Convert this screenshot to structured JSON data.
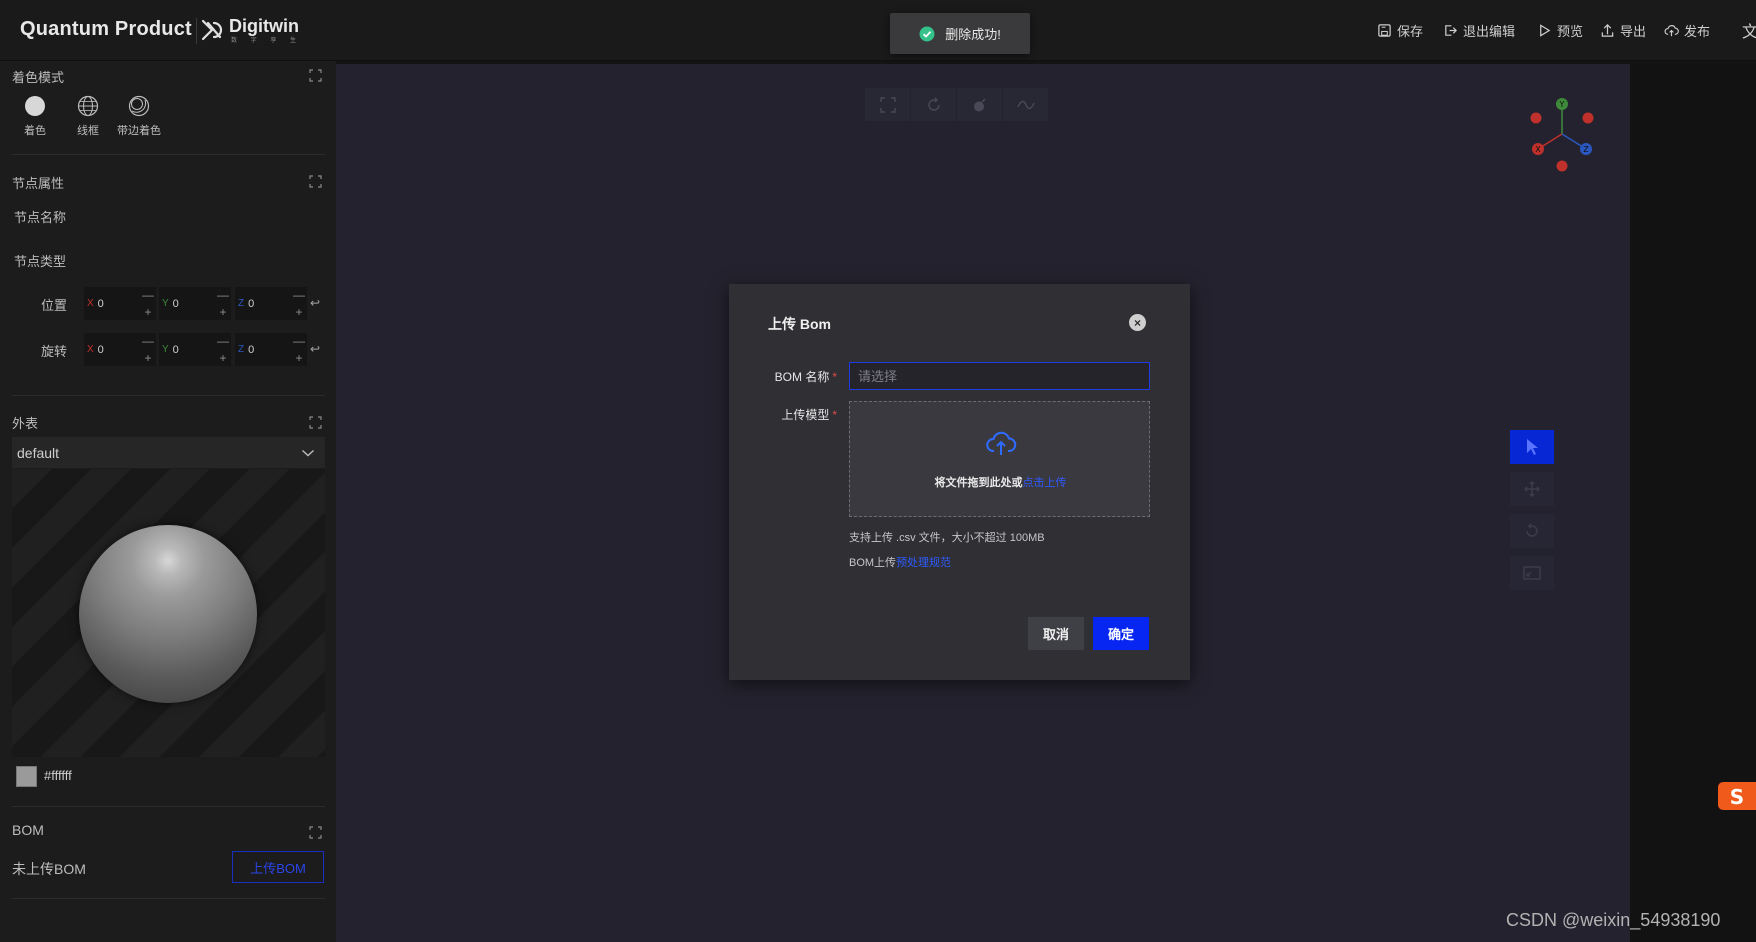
{
  "header": {
    "brand": "Quantum Product",
    "logo_text": "Digitwin",
    "logo_sub": "数 字 孪 生",
    "actions": [
      {
        "label": "保存",
        "icon": "save-icon"
      },
      {
        "label": "退出编辑",
        "icon": "exit-icon"
      },
      {
        "label": "预览",
        "icon": "play-icon"
      },
      {
        "label": "导出",
        "icon": "export-icon"
      },
      {
        "label": "发布",
        "icon": "cloud-upload-icon"
      }
    ],
    "lang": "文"
  },
  "toast": {
    "text": "删除成功!",
    "icon": "check-circle-icon",
    "color": "#35c28a"
  },
  "left": {
    "shading": {
      "title": "着色模式",
      "modes": [
        {
          "label": "着色",
          "icon": "solid-sphere-icon"
        },
        {
          "label": "线框",
          "icon": "wireframe-sphere-icon"
        },
        {
          "label": "带边着色",
          "icon": "shaded-edges-icon"
        }
      ]
    },
    "node": {
      "title": "节点属性",
      "name_label": "节点名称",
      "type_label": "节点类型",
      "position_label": "位置",
      "rotation_label": "旋转",
      "position": [
        {
          "axis": "X",
          "value": "0",
          "color": "#c0312b"
        },
        {
          "axis": "Y",
          "value": "0",
          "color": "#3f8a3a"
        },
        {
          "axis": "Z",
          "value": "0",
          "color": "#2b58c0"
        }
      ],
      "rotation": [
        {
          "axis": "X",
          "value": "0",
          "color": "#c0312b"
        },
        {
          "axis": "Y",
          "value": "0",
          "color": "#3f8a3a"
        },
        {
          "axis": "Z",
          "value": "0",
          "color": "#2b58c0"
        }
      ]
    },
    "appearance": {
      "title": "外表",
      "selected": "default",
      "swatch_label": "#ffffff"
    },
    "bom": {
      "title": "BOM",
      "status": "未上传BOM",
      "upload_button": "上传BOM"
    }
  },
  "viewport": {
    "toolbar": [
      "fullscreen-icon",
      "rotate-icon",
      "bomb-icon",
      "wave-icon"
    ],
    "right_tools": [
      "select-cursor-icon",
      "move-icon",
      "rotate-tool-icon",
      "scale-tool-icon"
    ],
    "watermark": "CSDN @weixin_54938190"
  },
  "dialog": {
    "title": "上传 Bom",
    "name_label": "BOM 名称",
    "name_placeholder": "请选择",
    "name_value": "",
    "model_label": "上传模型",
    "drop_text": "将文件拖到此处或",
    "drop_link": "点击上传",
    "hint1": "支持上传 .csv 文件，大小不超过 100MB",
    "hint2_prefix": "BOM上传",
    "hint2_link": "预处理规范",
    "cancel": "取消",
    "ok": "确定",
    "accent": "#0726f2"
  }
}
